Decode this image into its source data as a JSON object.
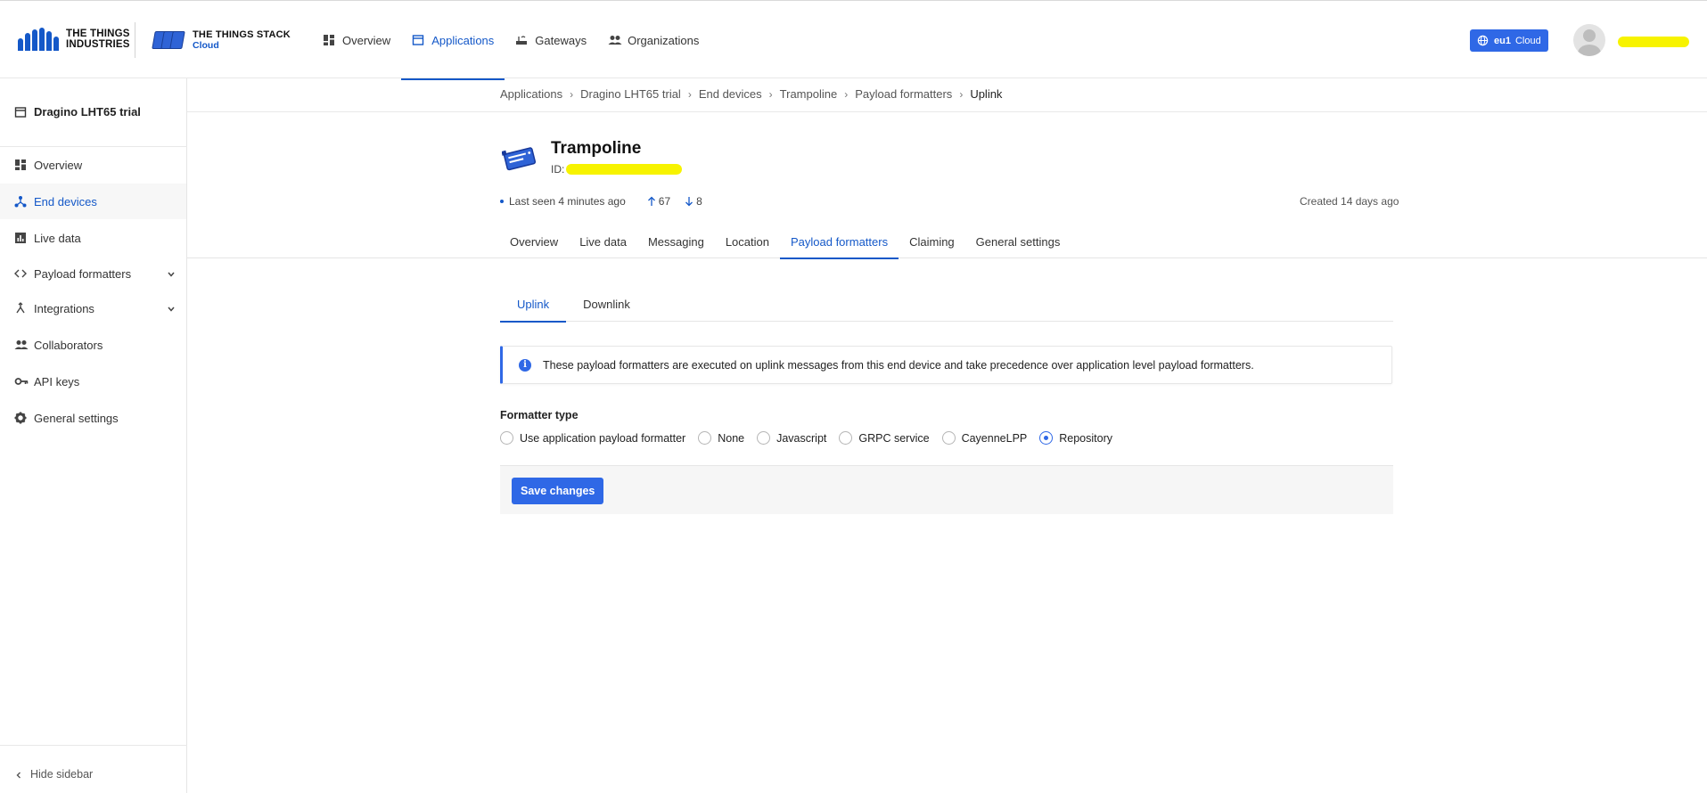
{
  "brand": {
    "tti_line1": "THE THINGS",
    "tti_line2": "INDUSTRIES",
    "tts_line1": "THE THINGS STACK",
    "tts_line2": "Cloud"
  },
  "topnav": {
    "items": [
      {
        "label": "Overview",
        "icon": "dashboard-icon"
      },
      {
        "label": "Applications",
        "icon": "application-icon",
        "active": true
      },
      {
        "label": "Gateways",
        "icon": "gateway-icon"
      },
      {
        "label": "Organizations",
        "icon": "organization-icon"
      }
    ]
  },
  "cluster": {
    "region": "eu1",
    "label": "Cloud"
  },
  "sidebar": {
    "app_name": "Dragino LHT65 trial",
    "items": [
      {
        "label": "Overview",
        "icon": "dashboard-icon"
      },
      {
        "label": "End devices",
        "icon": "devices-icon",
        "active": true
      },
      {
        "label": "Live data",
        "icon": "chart-icon"
      },
      {
        "label": "Payload formatters",
        "icon": "code-icon",
        "expandable": true
      },
      {
        "label": "Integrations",
        "icon": "integration-icon",
        "expandable": true
      },
      {
        "label": "Collaborators",
        "icon": "people-icon"
      },
      {
        "label": "API keys",
        "icon": "key-icon"
      },
      {
        "label": "General settings",
        "icon": "gear-icon"
      }
    ],
    "hide_label": "Hide sidebar"
  },
  "breadcrumb": [
    "Applications",
    "Dragino LHT65 trial",
    "End devices",
    "Trampoline",
    "Payload formatters",
    "Uplink"
  ],
  "device": {
    "name": "Trampoline",
    "id_label": "ID:",
    "last_seen": "Last seen 4 minutes ago",
    "uplink_count": "67",
    "downlink_count": "8",
    "created": "Created 14 days ago"
  },
  "tabs": [
    "Overview",
    "Live data",
    "Messaging",
    "Location",
    "Payload formatters",
    "Claiming",
    "General settings"
  ],
  "active_tab": "Payload formatters",
  "subtabs": [
    "Uplink",
    "Downlink"
  ],
  "notice": "These payload formatters are executed on uplink messages from this end device and take precedence over application level payload formatters.",
  "formatter": {
    "label": "Formatter type",
    "options": [
      "Use application payload formatter",
      "None",
      "Javascript",
      "GRPC service",
      "CayenneLPP",
      "Repository"
    ],
    "selected": "Repository"
  },
  "save_label": "Save changes",
  "colors": {
    "accent": "#1458c8",
    "button": "#2f68e6",
    "redaction": "#f7f300"
  }
}
